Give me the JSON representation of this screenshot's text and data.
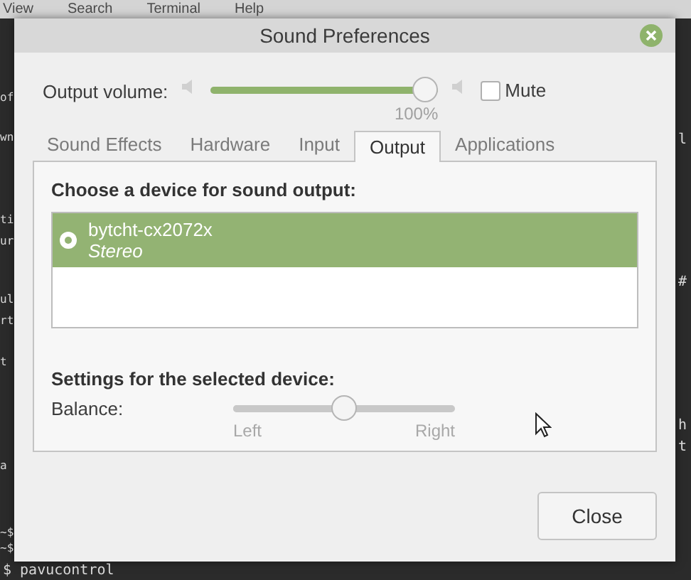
{
  "terminal": {
    "menu": [
      "View",
      "Search",
      "Terminal",
      "Help"
    ],
    "left_fragments": [
      "of",
      "wn",
      "ti",
      "ur",
      "ul",
      "rt",
      "t",
      "a",
      "~$",
      "~$"
    ],
    "right_fragments": [
      "l",
      "#",
      "h",
      "t"
    ],
    "last_line": "$ pavucontrol"
  },
  "window": {
    "title": "Sound Preferences"
  },
  "output_volume": {
    "label": "Output volume:",
    "level": 1.0,
    "reading": "100%",
    "mute": {
      "label": "Mute",
      "checked": false
    }
  },
  "tabs": [
    {
      "label": "Sound Effects",
      "selected": false
    },
    {
      "label": "Hardware",
      "selected": false
    },
    {
      "label": "Input",
      "selected": false
    },
    {
      "label": "Output",
      "selected": true
    },
    {
      "label": "Applications",
      "selected": false
    }
  ],
  "device_heading": "Choose a device for sound output:",
  "devices": [
    {
      "name": "bytcht-cx2072x",
      "profile": "Stereo",
      "selected": true
    }
  ],
  "settings_heading": "Settings for the selected device:",
  "balance": {
    "label": "Balance:",
    "level": 0.5,
    "left": "Left",
    "right": "Right"
  },
  "buttons": [
    "Close"
  ]
}
